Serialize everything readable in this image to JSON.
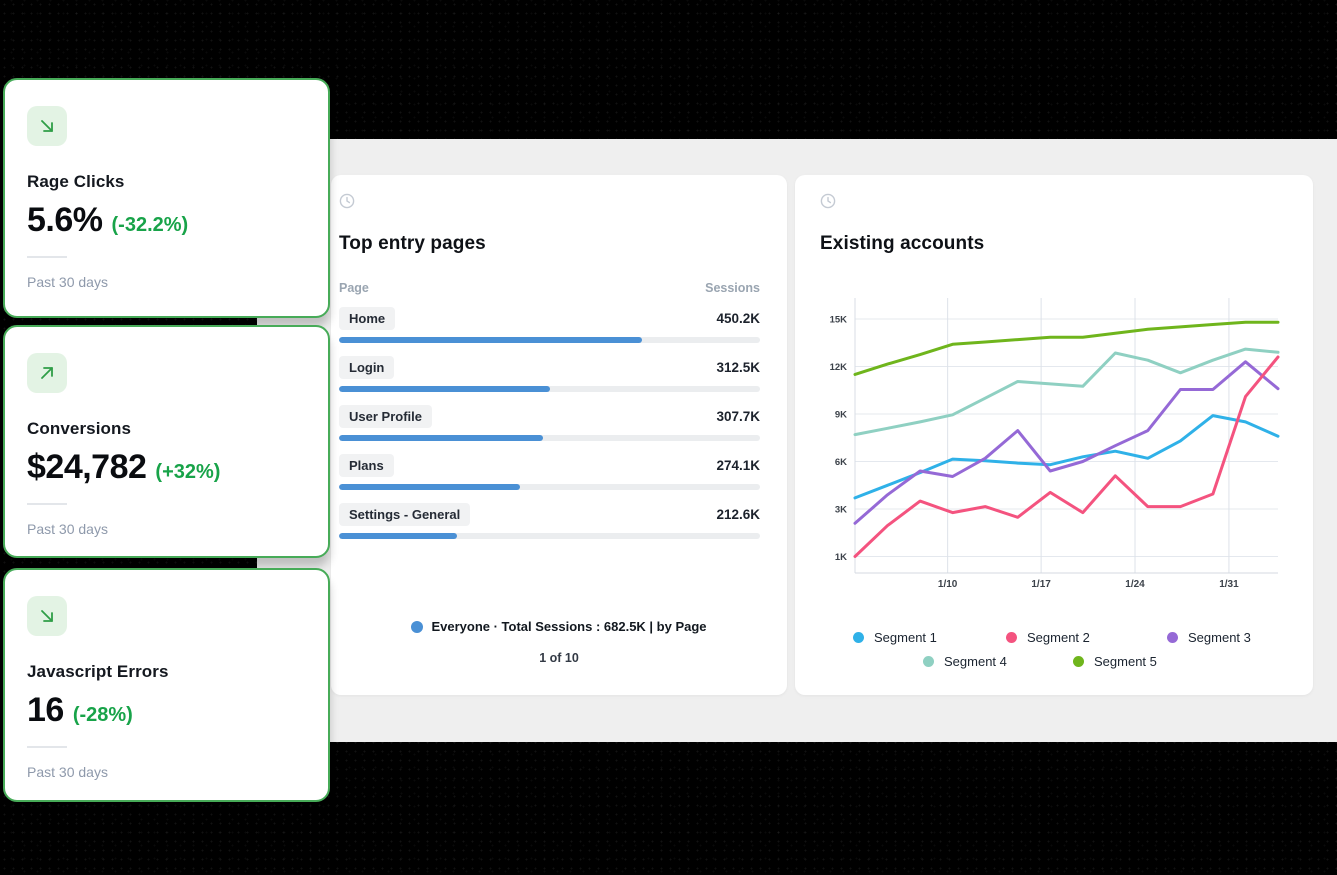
{
  "colors": {
    "background": "#000000",
    "panel": "#efefef",
    "card_border_green": "#47ab58",
    "kpi_icon_bg": "#e3f3e4",
    "kpi_icon_arrow": "#2f9e47",
    "delta_green": "#18a349",
    "bar_blue": "#4a90d5"
  },
  "kpi_cards": [
    {
      "title": "Rage Clicks",
      "value": "5.6%",
      "delta": "(-32.2%)",
      "period": "Past 30 days",
      "trend_icon": "arrow-down-right-icon"
    },
    {
      "title": "Conversions",
      "value": "$24,782",
      "delta": "(+32%)",
      "period": "Past 30 days",
      "trend_icon": "arrow-up-right-icon"
    },
    {
      "title": "Javascript Errors",
      "value": "16",
      "delta": "(-28%)",
      "period": "Past 30 days",
      "trend_icon": "arrow-down-right-icon"
    }
  ],
  "entry_pages": {
    "title": "Top entry pages",
    "columns": {
      "page": "Page",
      "sessions": "Sessions"
    },
    "rows": [
      {
        "page": "Home",
        "sessions": "450.2K",
        "bar_pct": 72
      },
      {
        "page": "Login",
        "sessions": "312.5K",
        "bar_pct": 50
      },
      {
        "page": "User Profile",
        "sessions": "307.7K",
        "bar_pct": 48.5
      },
      {
        "page": "Plans",
        "sessions": "274.1K",
        "bar_pct": 43
      },
      {
        "page": "Settings - General",
        "sessions": "212.6K",
        "bar_pct": 28
      }
    ],
    "legend": "Everyone ·  Total Sessions : 682.5K | by Page",
    "legend_dot_color": "#4a90d5",
    "pagination": "1 of 10"
  },
  "accounts_card": {
    "title": "Existing accounts",
    "chart_data": {
      "type": "line",
      "title": "Existing accounts",
      "y_tick_labels": [
        "15K",
        "12K",
        "9K",
        "6K",
        "3K",
        "1K"
      ],
      "y_tick_values": [
        15000,
        12000,
        9000,
        6000,
        3000,
        1000
      ],
      "x_gridline_labels": [
        "1/10",
        "1/17",
        "1/24",
        "1/31"
      ],
      "x_gridline_fracs": [
        0.219,
        0.44,
        0.662,
        0.884
      ],
      "grid": true,
      "legend_position": "bottom",
      "series": [
        {
          "name": "Segment 1",
          "color": "#2fb1e8",
          "values": [
            3700,
            4500,
            5300,
            6150,
            6050,
            5900,
            5800,
            6300,
            6650,
            6200,
            7300,
            8900,
            8500,
            7600
          ]
        },
        {
          "name": "Segment 2",
          "color": "#f4537f",
          "values": [
            1000,
            2300,
            3500,
            2850,
            3150,
            2650,
            4050,
            2850,
            5100,
            3150,
            3150,
            3950,
            10100,
            12600
          ]
        },
        {
          "name": "Segment 3",
          "color": "#9569d6",
          "values": [
            2400,
            3900,
            5400,
            5050,
            6200,
            7950,
            5400,
            6000,
            7000,
            7950,
            10550,
            10550,
            12300,
            10600
          ]
        },
        {
          "name": "Segment 4",
          "color": "#8fd0c2",
          "values": [
            7700,
            8100,
            8500,
            8950,
            10000,
            11050,
            10900,
            10750,
            12850,
            12400,
            11600,
            12400,
            13100,
            12900
          ]
        },
        {
          "name": "Segment 5",
          "color": "#6fb51c",
          "values": [
            11500,
            12150,
            12750,
            13400,
            13550,
            13700,
            13850,
            13850,
            14100,
            14350,
            14500,
            14650,
            14800,
            14800
          ]
        }
      ]
    }
  }
}
